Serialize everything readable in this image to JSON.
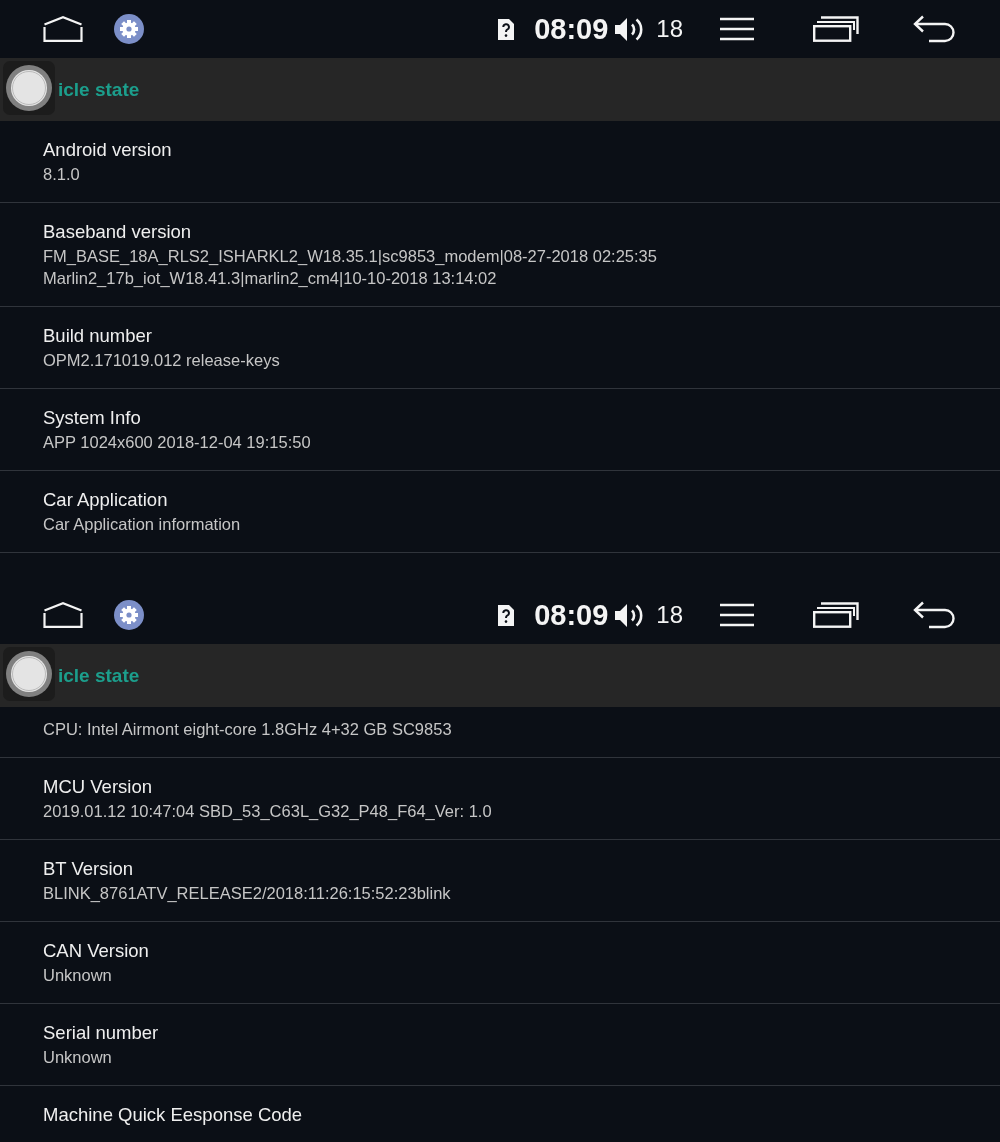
{
  "screens": [
    {
      "status_bar": {
        "time": "08:09",
        "volume": "18"
      },
      "header": {
        "title": "icle state"
      },
      "rows": [
        {
          "title": "Android version",
          "values": [
            "8.1.0"
          ]
        },
        {
          "title": "Baseband version",
          "values": [
            "FM_BASE_18A_RLS2_ISHARKL2_W18.35.1|sc9853_modem|08-27-2018 02:25:35",
            "Marlin2_17b_iot_W18.41.3|marlin2_cm4|10-10-2018 13:14:02"
          ]
        },
        {
          "title": "Build number",
          "values": [
            "OPM2.171019.012 release-keys"
          ]
        },
        {
          "title": "System Info",
          "values": [
            "APP 1024x600 2018-12-04 19:15:50"
          ]
        },
        {
          "title": "Car Application",
          "values": [
            "Car Application information"
          ]
        }
      ]
    },
    {
      "status_bar": {
        "time": "08:09",
        "volume": "18"
      },
      "header": {
        "title": "icle state"
      },
      "rows": [
        {
          "values": [
            "CPU: Intel Airmont eight-core 1.8GHz 4+32 GB SC9853"
          ]
        },
        {
          "title": "MCU Version",
          "values": [
            "2019.01.12 10:47:04 SBD_53_C63L_G32_P48_F64_Ver: 1.0"
          ]
        },
        {
          "title": "BT Version",
          "values": [
            "BLINK_8761ATV_RELEASE2/2018:11:26:15:52:23blink"
          ]
        },
        {
          "title": "CAN Version",
          "values": [
            "Unknown"
          ]
        },
        {
          "title": "Serial number",
          "values": [
            "Unknown"
          ]
        },
        {
          "title": "Machine Quick Eesponse Code"
        }
      ]
    }
  ]
}
